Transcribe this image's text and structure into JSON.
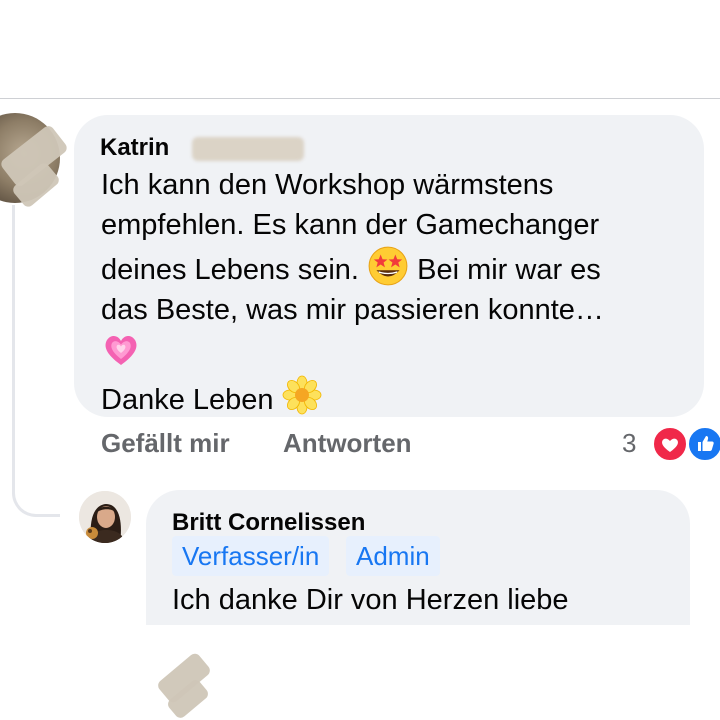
{
  "comment": {
    "author": "Katrin",
    "text_lines": [
      "Ich kann den Workshop wärmstens",
      "empfehlen. Es kann der Gamechanger",
      "deines Lebens sein.",
      "Bei mir war es",
      "das Beste, was mir passieren konnte…",
      "Danke Leben"
    ],
    "emojis": [
      "star-struck-emoji",
      "growing-heart-emoji",
      "blossom-emoji"
    ],
    "actions": {
      "like": "Gefällt mir",
      "reply": "Antworten"
    },
    "reaction_count": "3",
    "reactions": [
      "love-reaction-icon",
      "like-reaction-icon"
    ]
  },
  "reply": {
    "author": "Britt Cornelissen",
    "badges": [
      "Verfasser/in",
      "Admin"
    ],
    "text": "Ich danke Dir von Herzen liebe"
  },
  "colors": {
    "bubble": "#f0f2f5",
    "secondary_text": "#65676b",
    "badge_bg": "#e7f0fd",
    "badge_text": "#1877f2",
    "love": "#f02849",
    "like": "#1877f2"
  }
}
